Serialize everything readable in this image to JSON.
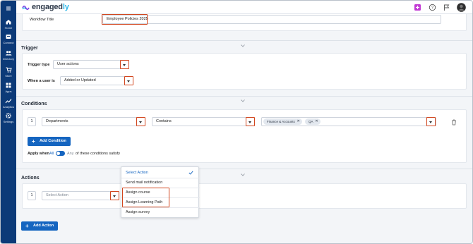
{
  "app": {
    "logo_text": "engaged",
    "logo_accent": "ly"
  },
  "sidebar": {
    "items": [
      {
        "label": "Home",
        "icon": "home-icon"
      },
      {
        "label": "Connect",
        "icon": "connect-icon"
      },
      {
        "label": "Directory",
        "icon": "directory-icon"
      },
      {
        "label": "Store",
        "icon": "store-icon"
      },
      {
        "label": "Apps",
        "icon": "apps-icon"
      },
      {
        "label": "Analytics",
        "icon": "analytics-icon"
      },
      {
        "label": "Settings",
        "icon": "gear-icon"
      }
    ]
  },
  "workflow": {
    "title_label": "Workflow Title",
    "title_value": "Employee Policies 2025"
  },
  "trigger": {
    "section_title": "Trigger",
    "type_label": "Trigger type",
    "type_value": "User actions",
    "when_label": "When a user is",
    "when_value": "Added or Updated"
  },
  "conditions": {
    "section_title": "Conditions",
    "row_number": "1",
    "field_value": "Departments",
    "operator_value": "Contains",
    "chips": [
      "Finance & Accounts",
      "QA"
    ],
    "add_label": "Add Condition",
    "apply_when_label": "Apply when",
    "all_label": "All",
    "any_label": "Any",
    "satisfy_text": "of these conditions satisfy"
  },
  "actions": {
    "section_title": "Actions",
    "row_number": "1",
    "select_placeholder": "Select Action",
    "add_label": "Add Action",
    "menu": [
      "Select Action",
      "Send mail notification",
      "Assign course",
      "Assign Learning Path",
      "Assign survey"
    ]
  },
  "colors": {
    "accent": "#1565c0",
    "highlight": "#d2461e",
    "sidebar": "#0c3a78"
  }
}
